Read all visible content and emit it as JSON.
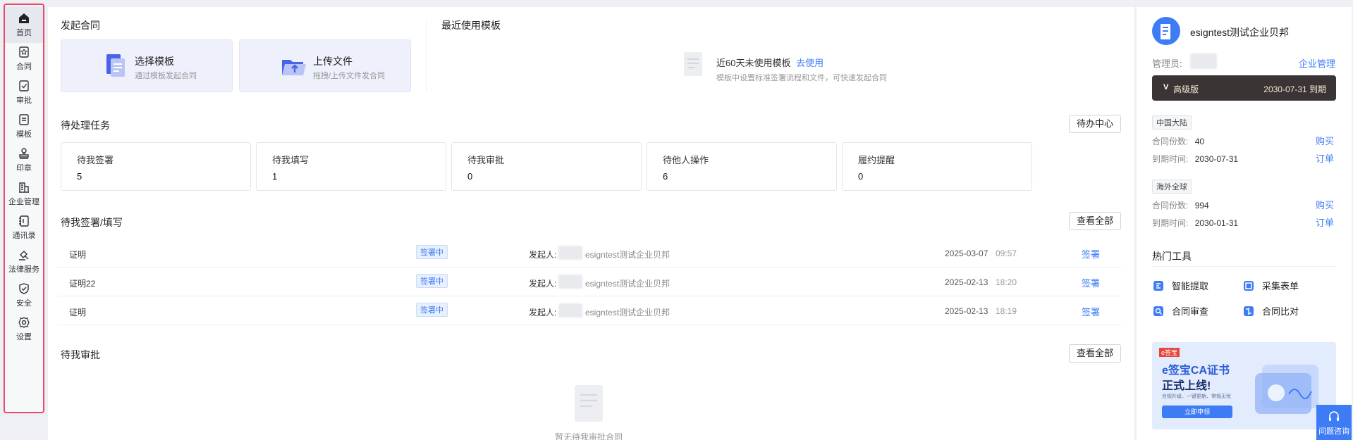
{
  "nav": {
    "items": [
      {
        "label": "首页",
        "icon": "home-icon"
      },
      {
        "label": "合同",
        "icon": "contract-icon"
      },
      {
        "label": "审批",
        "icon": "approval-icon"
      },
      {
        "label": "模板",
        "icon": "template-icon"
      },
      {
        "label": "印章",
        "icon": "seal-icon"
      },
      {
        "label": "企业管理",
        "icon": "enterprise-icon"
      },
      {
        "label": "通讯录",
        "icon": "contacts-icon"
      },
      {
        "label": "法律服务",
        "icon": "legal-service-icon"
      },
      {
        "label": "安全",
        "icon": "shield-icon"
      },
      {
        "label": "设置",
        "icon": "gear-icon"
      }
    ]
  },
  "start": {
    "title": "发起合同",
    "template_title": "选择模板",
    "template_sub": "通过模板发起合同",
    "upload_title": "上传文件",
    "upload_sub": "拖拽/上传文件发合同"
  },
  "recent": {
    "title": "最近使用模板",
    "empty_text": "近60天未使用模板",
    "empty_link": "去使用",
    "empty_sub": "模板中设置标准签署流程和文件，可快速发起合同"
  },
  "tasks": {
    "title": "待处理任务",
    "center_button": "待办中心",
    "items": [
      {
        "label": "待我签署",
        "value": "5"
      },
      {
        "label": "待我填写",
        "value": "1"
      },
      {
        "label": "待我审批",
        "value": "0"
      },
      {
        "label": "待他人操作",
        "value": "6"
      },
      {
        "label": "履约提醒",
        "value": "0"
      }
    ]
  },
  "sign": {
    "title": "待我签署/填写",
    "view_all": "查看全部",
    "rows": [
      {
        "name": "证明",
        "status": "签署中",
        "initiator_label": "发起人:",
        "initiator": "esigntest测试企业贝邦",
        "date": "2025-03-07",
        "time": "09:57",
        "action": "签署"
      },
      {
        "name": "证明22",
        "status": "签署中",
        "initiator_label": "发起人:",
        "initiator": "esigntest测试企业贝邦",
        "date": "2025-02-13",
        "time": "18:20",
        "action": "签署"
      },
      {
        "name": "证明",
        "status": "签署中",
        "initiator_label": "发起人:",
        "initiator": "esigntest测试企业贝邦",
        "date": "2025-02-13",
        "time": "18:19",
        "action": "签署"
      }
    ]
  },
  "approve": {
    "title": "待我审批",
    "view_all": "查看全部",
    "empty_text": "暂无待我审批合同"
  },
  "company": {
    "name": "esigntest测试企业贝邦",
    "admin_label": "管理员:",
    "manage_link": "企业管理",
    "edition": "高级版",
    "expire": "2030-07-31 到期"
  },
  "quota": [
    {
      "region": "中国大陆",
      "count_label": "合同份数:",
      "count": "40",
      "buy": "购买",
      "expire_label": "到期时间:",
      "expire": "2030-07-31",
      "order": "订单"
    },
    {
      "region": "海外全球",
      "count_label": "合同份数:",
      "count": "994",
      "buy": "购买",
      "expire_label": "到期时间:",
      "expire": "2030-01-31",
      "order": "订单"
    }
  ],
  "tools": {
    "title": "热门工具",
    "items": [
      "智能提取",
      "采集表单",
      "合同审查",
      "合同比对"
    ]
  },
  "banner": {
    "brand": "e签宝",
    "headline": "e签宝CA证书",
    "headline2": "正式上线!",
    "sub": "合规升级、一键更新、常规无忧",
    "cta": "立即申领"
  },
  "help": {
    "label": "问题咨询"
  },
  "colors": {
    "accent": "#3e7cf6",
    "nav_border": "#e84a6b",
    "edition_bg": "#3b3434"
  }
}
